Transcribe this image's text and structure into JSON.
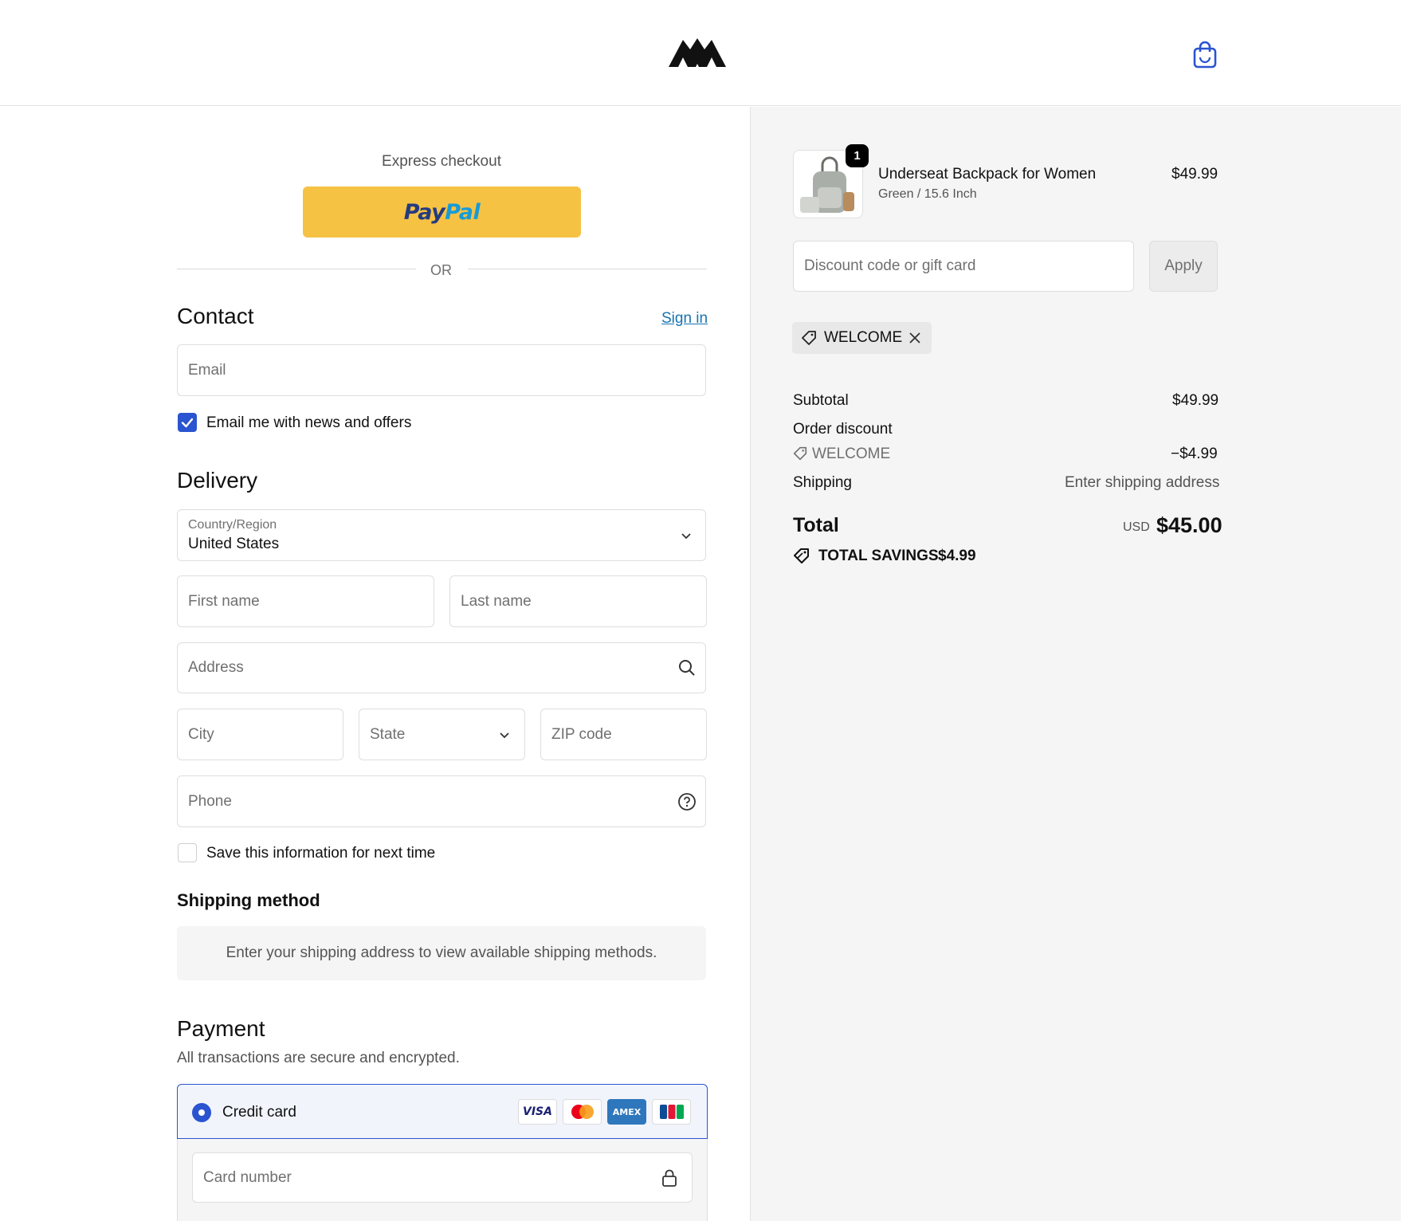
{
  "header": {
    "logo_name": "mountain-logo-icon",
    "cart_name": "shopping-bag-icon"
  },
  "express": {
    "title": "Express checkout",
    "paypal_a": "Pay",
    "paypal_b": "Pal",
    "or": "OR"
  },
  "contact": {
    "title": "Contact",
    "sign_in": "Sign in",
    "email_placeholder": "Email",
    "newsletter_label": "Email me with news and offers",
    "newsletter_checked": true
  },
  "delivery": {
    "title": "Delivery",
    "country_label": "Country/Region",
    "country_value": "United States",
    "first_name": "First name",
    "last_name": "Last name",
    "address": "Address",
    "city": "City",
    "state": "State",
    "zip": "ZIP code",
    "phone": "Phone",
    "save_label": "Save this information for next time",
    "save_checked": false
  },
  "shipping": {
    "title": "Shipping method",
    "message": "Enter your shipping address to view available shipping methods."
  },
  "payment": {
    "title": "Payment",
    "subtitle": "All transactions are secure and encrypted.",
    "method": "Credit card",
    "card_brands": [
      "VISA",
      "Mastercard",
      "AMEX",
      "JCB"
    ],
    "card_number": "Card number"
  },
  "order": {
    "item_name": "Underseat Backpack for Women",
    "item_variant": "Green / 15.6 Inch",
    "item_price": "$49.99",
    "qty": "1",
    "discount_placeholder": "Discount code or gift card",
    "apply": "Apply",
    "code": "WELCOME",
    "subtotal_label": "Subtotal",
    "subtotal": "$49.99",
    "order_discount_label": "Order discount",
    "discount_code": "WELCOME",
    "discount_amount": "−$4.99",
    "shipping_label": "Shipping",
    "shipping_value": "Enter shipping address",
    "total_label": "Total",
    "currency": "USD",
    "total": "$45.00",
    "savings_label": "TOTAL SAVINGS",
    "savings": "$4.99"
  },
  "colors": {
    "accent": "#2a54d0",
    "paypal_yellow": "#f6c244",
    "link": "#1773b0"
  }
}
